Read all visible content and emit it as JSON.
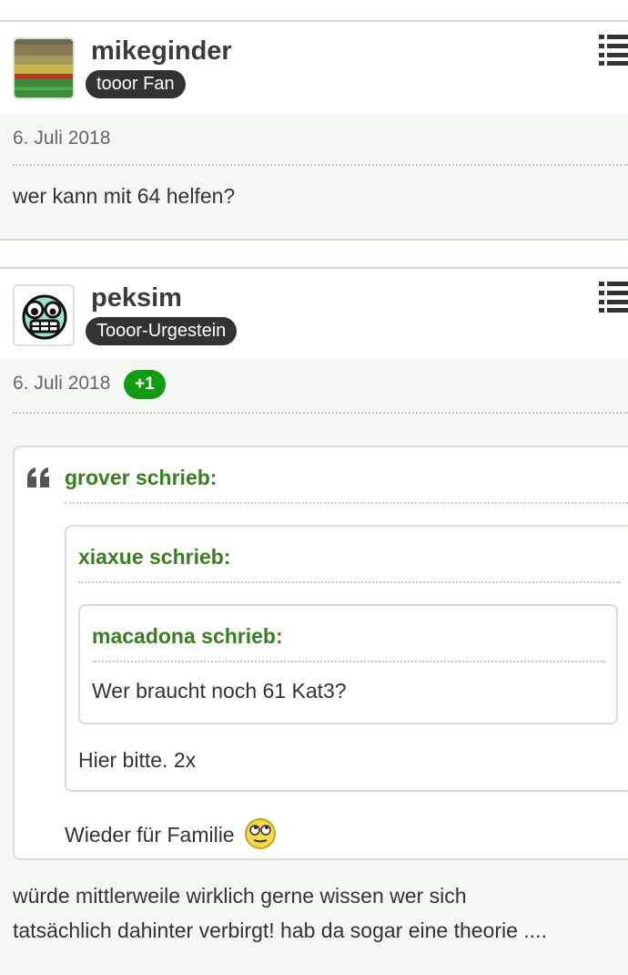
{
  "posts": [
    {
      "username": "mikeginder",
      "rank": "tooor Fan",
      "date": "6. Juli 2018",
      "text": "wer kann mit 64 helfen?"
    },
    {
      "username": "peksim",
      "rank": "Tooor-Urgestein",
      "date": "6. Juli 2018",
      "likes": "+1",
      "quote": {
        "author": "grover schrieb:",
        "nested": {
          "author": "xiaxue schrieb:",
          "nested": {
            "author": "macadona schrieb:",
            "text": "Wer braucht noch 61 Kat3?"
          },
          "text": "Hier bitte. 2x"
        },
        "text": "Wieder für Familie"
      },
      "text_line1": "würde mittlerweile wirklich gerne wissen wer sich",
      "text_line2": "tatsächlich dahinter verbirgt! hab da sogar eine theorie ...."
    }
  ],
  "icons": {
    "menu": "list-menu-icon",
    "quote": "quote-mark-icon",
    "smiley": "rolling-eyes-smiley-icon"
  },
  "colors": {
    "quote_author": "#3b7d22",
    "like_badge": "#149b14",
    "rank_badge": "#333333"
  }
}
